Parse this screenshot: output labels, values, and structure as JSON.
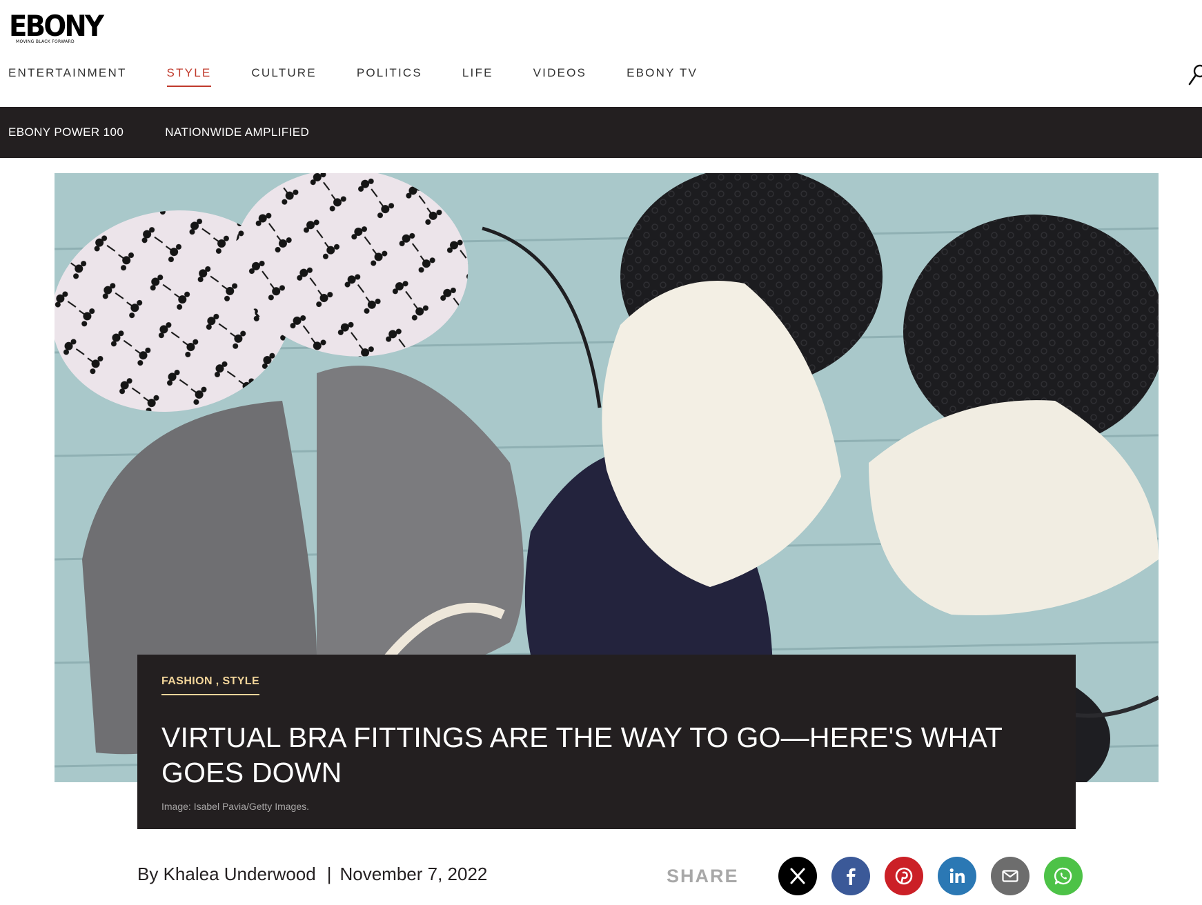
{
  "brand": {
    "logo": "EBONY",
    "tagline": "MOVING BLACK FORWARD"
  },
  "main_nav": {
    "items": [
      {
        "label": "ENTERTAINMENT"
      },
      {
        "label": "STYLE",
        "active": true
      },
      {
        "label": "CULTURE"
      },
      {
        "label": "POLITICS"
      },
      {
        "label": "LIFE"
      },
      {
        "label": "VIDEOS"
      },
      {
        "label": "EBONY TV"
      }
    ],
    "search_icon": "search-icon"
  },
  "sub_nav": {
    "items": [
      {
        "label": "EBONY POWER 100"
      },
      {
        "label": "NATIONWIDE AMPLIFIED"
      }
    ]
  },
  "article": {
    "categories": [
      "FASHION",
      "STYLE"
    ],
    "category_separator": " , ",
    "headline": "VIRTUAL BRA FITTINGS ARE THE WAY TO GO—HERE'S WHAT GOES DOWN",
    "image_caption": "Image: Isabel Pavia/Getty Images.",
    "byline": "By Khalea Underwood",
    "separator": "|",
    "date": "November 7, 2022"
  },
  "share": {
    "label": "SHARE",
    "buttons": [
      {
        "icon": "x-icon",
        "color": "#000000"
      },
      {
        "icon": "facebook-icon",
        "color": "#3b5998"
      },
      {
        "icon": "pinterest-icon",
        "color": "#cb2027"
      },
      {
        "icon": "linkedin-icon",
        "color": "#2b78b4"
      },
      {
        "icon": "email-icon",
        "color": "#6d6d6d"
      },
      {
        "icon": "whatsapp-icon",
        "color": "#4dc247"
      }
    ]
  },
  "colors": {
    "accent": "#c0392b",
    "dark_bar": "#231f20",
    "category_gold": "#f2d59a"
  }
}
